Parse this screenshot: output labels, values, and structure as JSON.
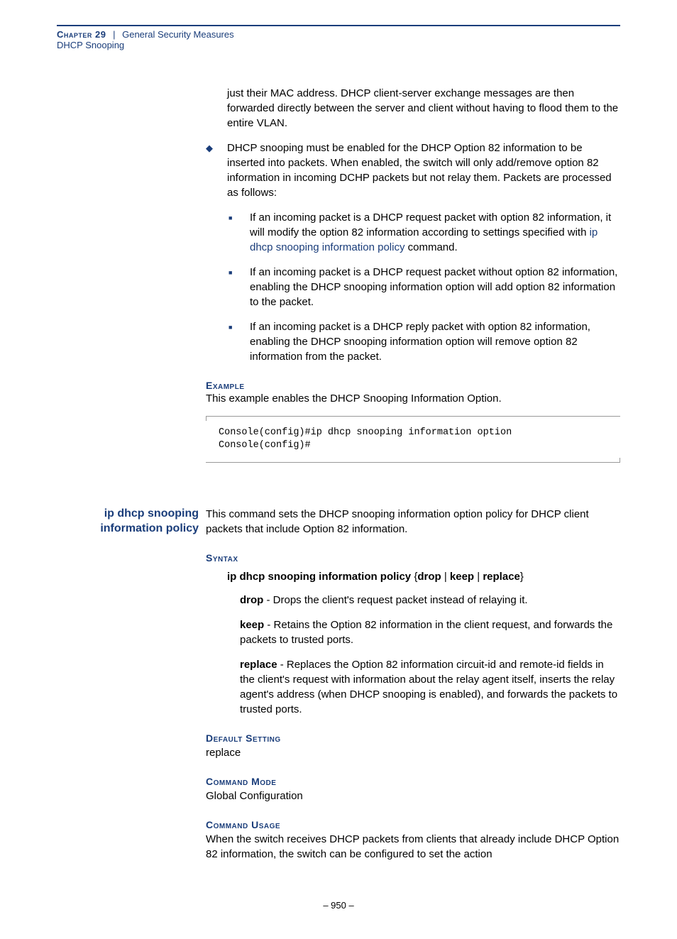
{
  "header": {
    "chapter": "Chapter 29",
    "title": "General Security Measures",
    "subtitle": "DHCP Snooping"
  },
  "intro_cont": "just their MAC address. DHCP client-server exchange messages are then forwarded directly between the server and client without having to flood them to the entire VLAN.",
  "bullet_main": "DHCP snooping must be enabled for the DHCP Option 82 information to be inserted into packets. When enabled, the switch will only add/remove option 82 information in incoming DCHP packets but not relay them. Packets are processed as follows:",
  "sub_bullets": {
    "b1_a": "If an incoming packet is a DHCP request packet with option 82 information, it will modify the option 82 information according to settings specified with ",
    "b1_link": "ip dhcp snooping information policy",
    "b1_b": " command.",
    "b2": "If an incoming packet is a DHCP request packet without option 82 information, enabling the DHCP snooping information option will add option 82 information to the packet.",
    "b3": "If an incoming packet is a DHCP reply packet with option 82 information, enabling the DHCP snooping information option will remove option 82 information from the packet."
  },
  "example": {
    "head": "Example",
    "text": "This example enables the DHCP Snooping Information Option.",
    "code": "Console(config)#ip dhcp snooping information option\nConsole(config)#"
  },
  "cmd": {
    "name": "ip dhcp snooping information policy",
    "desc": "This command sets the DHCP snooping information option policy for DHCP client packets that include Option 82 information."
  },
  "syntax": {
    "head": "Syntax",
    "cmd": "ip dhcp snooping information policy",
    "opts_open": " {",
    "o1": "drop",
    "sep": " | ",
    "o2": "keep",
    "o3": "replace",
    "opts_close": "}",
    "drop_k": "drop",
    "drop_t": " - Drops the client's request packet instead of relaying it.",
    "keep_k": "keep",
    "keep_t": " - Retains the Option 82 information in the client request, and forwards the packets to trusted ports.",
    "replace_k": "replace",
    "replace_t": " - Replaces the Option 82 information circuit-id and remote-id fields in the client's request with information about the relay agent itself, inserts the relay agent's address (when DHCP snooping is enabled), and forwards the packets to trusted ports."
  },
  "default": {
    "head": "Default Setting",
    "text": "replace"
  },
  "mode": {
    "head": "Command Mode",
    "text": "Global Configuration"
  },
  "usage": {
    "head": "Command Usage",
    "text": "When the switch receives DHCP packets from clients that already include DHCP Option 82 information, the switch can be configured to set the action"
  },
  "footer": "–  950  –"
}
